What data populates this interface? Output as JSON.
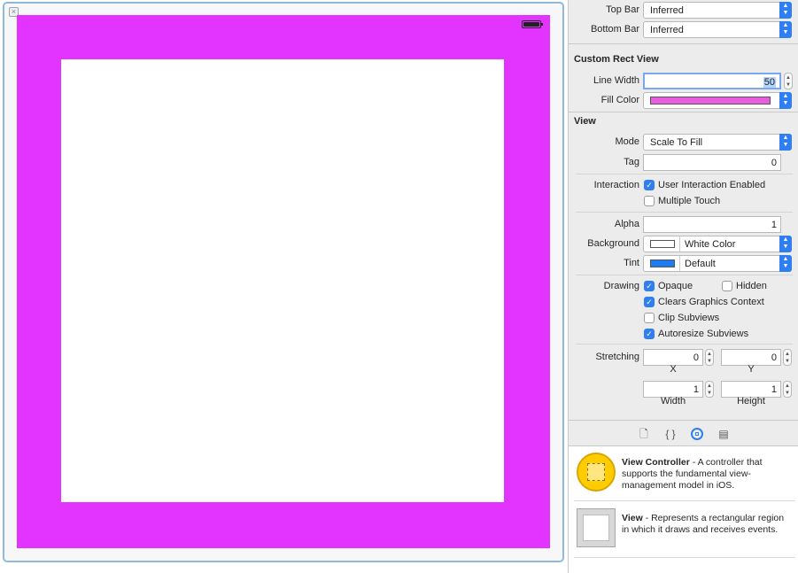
{
  "simulated_metrics": {
    "top_bar": {
      "label": "Top Bar",
      "value": "Inferred"
    },
    "bottom_bar": {
      "label": "Bottom Bar",
      "value": "Inferred"
    }
  },
  "custom_rect_view": {
    "title": "Custom Rect View",
    "line_width": {
      "label": "Line Width",
      "value": "50"
    },
    "fill_color": {
      "label": "Fill Color",
      "color": "#e95ce0"
    }
  },
  "view": {
    "title": "View",
    "mode": {
      "label": "Mode",
      "value": "Scale To Fill"
    },
    "tag": {
      "label": "Tag",
      "value": "0"
    },
    "interaction": {
      "label": "Interaction",
      "user_interaction_enabled": {
        "label": "User Interaction Enabled",
        "checked": true
      },
      "multiple_touch": {
        "label": "Multiple Touch",
        "checked": false
      }
    },
    "alpha": {
      "label": "Alpha",
      "value": "1"
    },
    "background": {
      "label": "Background",
      "value": "White Color",
      "color": "#ffffff"
    },
    "tint": {
      "label": "Tint",
      "value": "Default",
      "color": "#1d7cf2"
    },
    "drawing": {
      "label": "Drawing",
      "opaque": {
        "label": "Opaque",
        "checked": true
      },
      "hidden": {
        "label": "Hidden",
        "checked": false
      },
      "clears_graphics_context": {
        "label": "Clears Graphics Context",
        "checked": true
      },
      "clip_subviews": {
        "label": "Clip Subviews",
        "checked": false
      },
      "autoresize_subviews": {
        "label": "Autoresize Subviews",
        "checked": true
      }
    },
    "stretching": {
      "label": "Stretching",
      "x": {
        "label": "X",
        "value": "0"
      },
      "y": {
        "label": "Y",
        "value": "0"
      },
      "width": {
        "label": "Width",
        "value": "1"
      },
      "height": {
        "label": "Height",
        "value": "1"
      }
    }
  },
  "library": {
    "items": [
      {
        "name": "View Controller",
        "description": " - A controller that supports the fundamental view-management model in iOS."
      },
      {
        "name": "View",
        "description": " - Represents a rectangular region in which it draws and receives events."
      }
    ]
  },
  "canvas": {
    "view_color": "#e233ff",
    "inner_color": "#ffffff",
    "close_glyph": "×"
  }
}
